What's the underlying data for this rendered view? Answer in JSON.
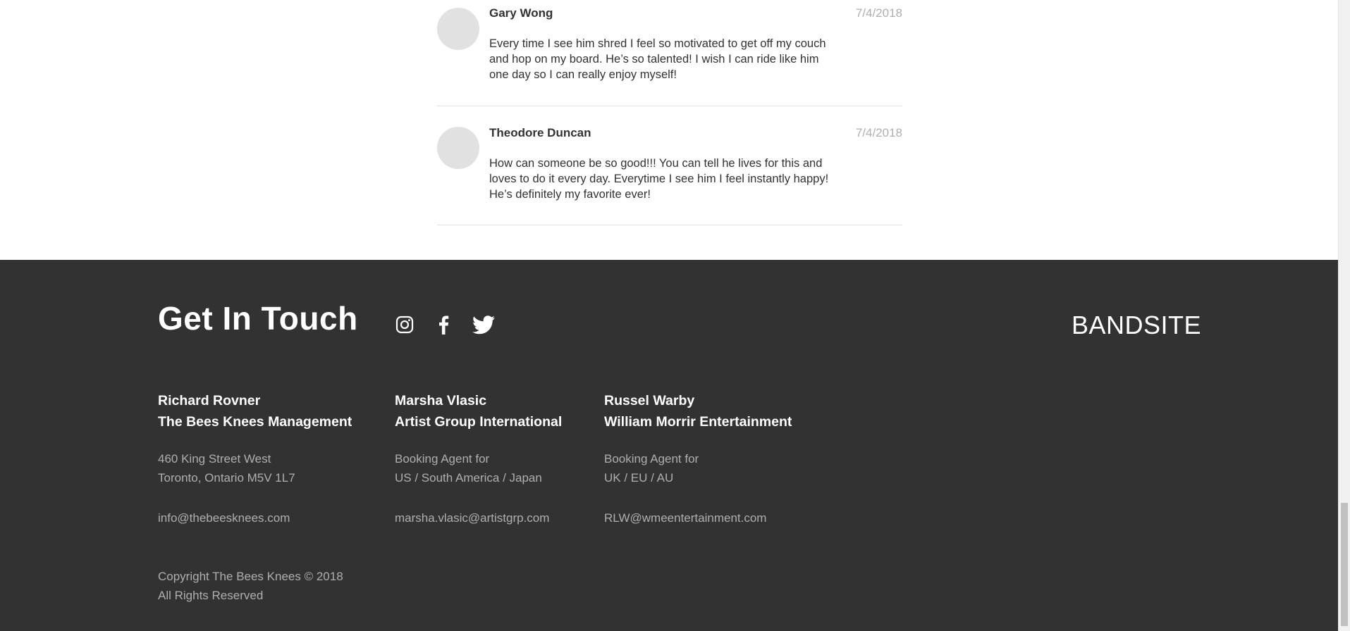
{
  "comments": [
    {
      "name": "Gary Wong",
      "date": "7/4/2018",
      "text": "Every time I see him shred I feel so motivated to get off my couch and hop on my board. He’s so talented! I wish I can ride like him one day so I can really enjoy myself!"
    },
    {
      "name": "Theodore Duncan",
      "date": "7/4/2018",
      "text": "How can someone be so good!!! You can tell he lives for this and loves to do it every day. Everytime I see him I feel instantly happy! He’s definitely my favorite ever!"
    }
  ],
  "footer": {
    "title": "Get In Touch",
    "brand": "BANDSITE",
    "social": [
      "instagram-icon",
      "facebook-icon",
      "twitter-icon"
    ],
    "contacts": [
      {
        "name": "Richard Rovner",
        "org": "The Bees Knees Management",
        "line1": "460 King Street West",
        "line2": "Toronto, Ontario M5V 1L7",
        "email": "info@thebeesknees.com"
      },
      {
        "name": "Marsha Vlasic",
        "org": "Artist Group International",
        "line1": "Booking Agent for",
        "line2": "US / South America / Japan",
        "email": "marsha.vlasic@artistgrp.com"
      },
      {
        "name": "Russel Warby",
        "org": "William Morrir Entertainment",
        "line1": "Booking Agent for",
        "line2": "UK / EU / AU",
        "email": "RLW@wmeentertainment.com"
      }
    ],
    "copyright_line1": "Copyright The Bees Knees © 2018",
    "copyright_line2": "All Rights Reserved"
  },
  "colors": {
    "footer_bg": "#323232",
    "text_dark": "#323232",
    "text_muted": "#afafaf",
    "avatar": "#e1e1e1",
    "divider": "#e1e1e1"
  }
}
